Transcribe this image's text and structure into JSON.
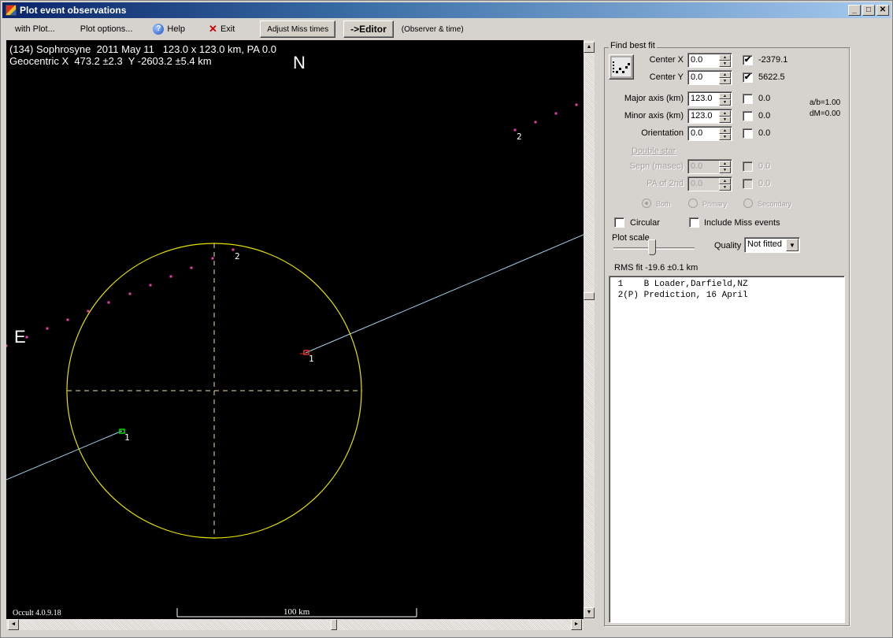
{
  "window": {
    "title": "Plot event observations",
    "controls": [
      "minimize",
      "maximize",
      "close"
    ]
  },
  "toolbar": {
    "with_plot": "with Plot...",
    "plot_options": "Plot options...",
    "help": "Help",
    "exit": "Exit",
    "adjust_miss": "Adjust Miss times",
    "editor": "->Editor",
    "observer_time": "(Observer & time)"
  },
  "plot": {
    "title_line1": "(134) Sophrosyne  2011 May 11   123.0 x 123.0 km, PA 0.0",
    "title_line2": "Geocentric X  473.2 ±2.3  Y -2603.2 ±5.4 km",
    "north": "N",
    "east": "E",
    "version": "Occult 4.0.9.18",
    "scale_label": "100 km",
    "colors": {
      "background": "#000000",
      "ellipse": "#e8e000",
      "axes": "#f0e0a0",
      "chord": "#a0d0e8",
      "prediction": "#e040a0",
      "obs_start": "#00e000",
      "obs_end": "#e03030"
    },
    "chord_labels": [
      "1",
      "1"
    ],
    "prediction_labels": [
      "2",
      "2"
    ]
  },
  "panel": {
    "group_title": "Find best fit",
    "fields": [
      {
        "label": "Center X",
        "value": "0.0",
        "checked": true,
        "result": "-2379.1"
      },
      {
        "label": "Center Y",
        "value": "0.0",
        "checked": true,
        "result": "5622.5"
      },
      {
        "label": "Major axis (km)",
        "value": "123.0",
        "checked": false,
        "result": "0.0"
      },
      {
        "label": "Minor axis (km)",
        "value": "123.0",
        "checked": false,
        "result": "0.0"
      },
      {
        "label": "Orientation",
        "value": "0.0",
        "checked": false,
        "result": "0.0"
      }
    ],
    "ab_ratio": "a/b=1.00",
    "dm": "dM=0.00",
    "double_star": "Double star",
    "double_fields": [
      {
        "label": "Sepn (masec)",
        "value": "0.0",
        "checked": false,
        "result": "0.0"
      },
      {
        "label": "PA of 2nd",
        "value": "0.0",
        "checked": false,
        "result": "0.0"
      }
    ],
    "radios": [
      {
        "label": "Both",
        "selected": true
      },
      {
        "label": "Primary",
        "selected": false
      },
      {
        "label": "Secondary",
        "selected": false
      }
    ],
    "circular": {
      "label": "Circular",
      "checked": false
    },
    "include_miss": {
      "label": "Include Miss events",
      "checked": false
    },
    "plot_scale_label": "Plot scale",
    "quality_label": "Quality",
    "quality_value": "Not fitted",
    "rms": "RMS fit -19.6 ±0.1 km",
    "observers": [
      " 1    B Loader,Darfield,NZ",
      " 2(P) Prediction, 16 April"
    ]
  }
}
